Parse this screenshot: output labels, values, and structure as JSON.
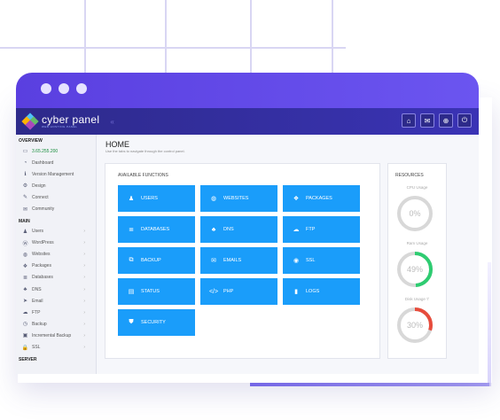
{
  "logo": {
    "name": "cyber panel",
    "tagline": "WEB HOSTING PANEL"
  },
  "topbar": {
    "collapse_glyph": "«"
  },
  "sidebar": {
    "overview_title": "OVERVIEW",
    "overview_items": [
      {
        "label": "3.65.255.200",
        "icon": "monitor-icon",
        "glyph": "▭"
      },
      {
        "label": "Dashboard",
        "icon": "dashboard-icon",
        "glyph": "◔"
      },
      {
        "label": "Version Management",
        "icon": "info-icon",
        "glyph": "ℹ"
      },
      {
        "label": "Design",
        "icon": "gear-icon",
        "glyph": "⚙"
      },
      {
        "label": "Connect",
        "icon": "plug-icon",
        "glyph": "✎"
      },
      {
        "label": "Community",
        "icon": "comments-icon",
        "glyph": "✉"
      }
    ],
    "main_title": "MAIN",
    "main_items": [
      {
        "label": "Users",
        "icon": "users-icon",
        "glyph": "♟"
      },
      {
        "label": "WordPress",
        "icon": "wordpress-icon",
        "glyph": "Ⓦ"
      },
      {
        "label": "Websites",
        "icon": "globe-icon",
        "glyph": "◍"
      },
      {
        "label": "Packages",
        "icon": "cubes-icon",
        "glyph": "❖"
      },
      {
        "label": "Databases",
        "icon": "database-icon",
        "glyph": "≣"
      },
      {
        "label": "DNS",
        "icon": "sitemap-icon",
        "glyph": "♣"
      },
      {
        "label": "Email",
        "icon": "send-icon",
        "glyph": "➤"
      },
      {
        "label": "FTP",
        "icon": "cloud-upload-icon",
        "glyph": "☁"
      },
      {
        "label": "Backup",
        "icon": "backup-icon",
        "glyph": "◷"
      },
      {
        "label": "Incremental Backup",
        "icon": "save-icon",
        "glyph": "▣"
      },
      {
        "label": "SSL",
        "icon": "lock-icon",
        "glyph": "🔒"
      }
    ],
    "server_title": "SERVER"
  },
  "main": {
    "title": "HOME",
    "subtitle": "Use the tabs to navigate through the control panel.",
    "functions_title": "AVAILABLE FUNCTIONS",
    "functions": [
      {
        "label": "USERS",
        "icon": "users-icon",
        "glyph": "♟"
      },
      {
        "label": "WEBSITES",
        "icon": "globe-icon",
        "glyph": "◍"
      },
      {
        "label": "PACKAGES",
        "icon": "cubes-icon",
        "glyph": "❖"
      },
      {
        "label": "DATABASES",
        "icon": "database-icon",
        "glyph": "≣"
      },
      {
        "label": "DNS",
        "icon": "sitemap-icon",
        "glyph": "♣"
      },
      {
        "label": "FTP",
        "icon": "cloud-upload-icon",
        "glyph": "☁"
      },
      {
        "label": "BACKUP",
        "icon": "backup-icon",
        "glyph": "⧉"
      },
      {
        "label": "EMAILS",
        "icon": "envelope-icon",
        "glyph": "✉"
      },
      {
        "label": "SSL",
        "icon": "ssl-icon",
        "glyph": "◉"
      },
      {
        "label": "STATUS",
        "icon": "server-icon",
        "glyph": "▤"
      },
      {
        "label": "PHP",
        "icon": "code-icon",
        "glyph": "</>"
      },
      {
        "label": "LOGS",
        "icon": "file-icon",
        "glyph": "▮"
      },
      {
        "label": "SECURITY",
        "icon": "shield-icon",
        "glyph": "⛊"
      }
    ],
    "resources_title": "RESOURCES",
    "resources": [
      {
        "label": "CPU Usage",
        "value_text": "0%",
        "value": 0
      },
      {
        "label": "Ram Usage",
        "value_text": "49%",
        "value": 49
      },
      {
        "label": "Disk Usage '/'",
        "value_text": "30%",
        "value": 30
      }
    ]
  },
  "colors": {
    "titlebar": "#5a3fe0",
    "topbar": "#2d2a8a",
    "function_button": "#1a9dfa",
    "ram_gauge": "#2ecc71",
    "disk_gauge": "#e74c3c",
    "gauge_track": "#d8d8d8",
    "ip_text": "#1a8f3e"
  }
}
